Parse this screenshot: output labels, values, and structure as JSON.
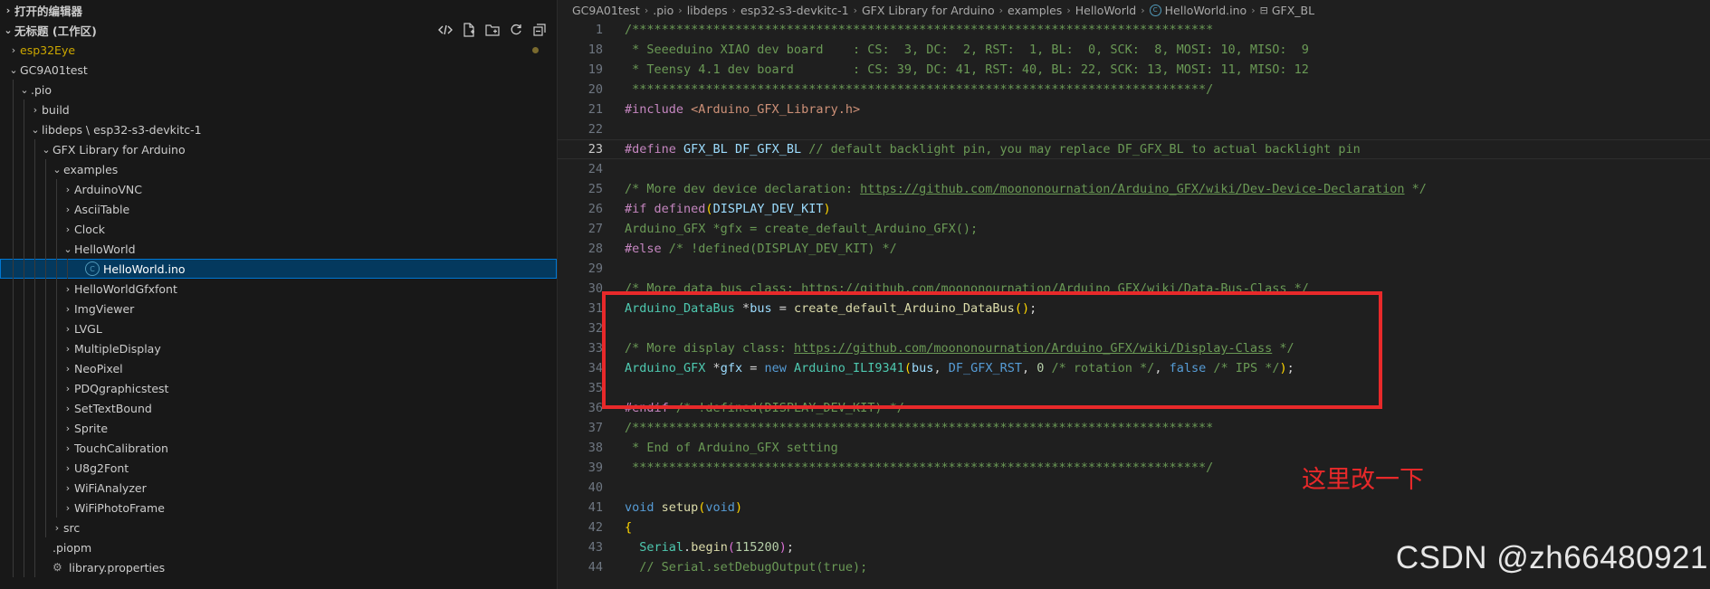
{
  "sidebar": {
    "open_editors_label": "打开的编辑器",
    "workspace_label": "无标题 (工作区)",
    "tree": [
      {
        "label": "esp32Eye",
        "depth": 0,
        "chev": "right",
        "yellow": true,
        "dot": true
      },
      {
        "label": "GC9A01test",
        "depth": 0,
        "chev": "down"
      },
      {
        "label": ".pio",
        "depth": 1,
        "chev": "down"
      },
      {
        "label": "build",
        "depth": 2,
        "chev": "right"
      },
      {
        "label": "libdeps \\ esp32-s3-devkitc-1",
        "depth": 2,
        "chev": "down"
      },
      {
        "label": "GFX Library for Arduino",
        "depth": 3,
        "chev": "down"
      },
      {
        "label": "examples",
        "depth": 4,
        "chev": "down"
      },
      {
        "label": "ArduinoVNC",
        "depth": 5,
        "chev": "right"
      },
      {
        "label": "AsciiTable",
        "depth": 5,
        "chev": "right"
      },
      {
        "label": "Clock",
        "depth": 5,
        "chev": "right"
      },
      {
        "label": "HelloWorld",
        "depth": 5,
        "chev": "down"
      },
      {
        "label": "HelloWorld.ino",
        "depth": 6,
        "chev": "none",
        "icon": "c",
        "selected": true
      },
      {
        "label": "HelloWorldGfxfont",
        "depth": 5,
        "chev": "right"
      },
      {
        "label": "ImgViewer",
        "depth": 5,
        "chev": "right"
      },
      {
        "label": "LVGL",
        "depth": 5,
        "chev": "right"
      },
      {
        "label": "MultipleDisplay",
        "depth": 5,
        "chev": "right"
      },
      {
        "label": "NeoPixel",
        "depth": 5,
        "chev": "right"
      },
      {
        "label": "PDQgraphicstest",
        "depth": 5,
        "chev": "right"
      },
      {
        "label": "SetTextBound",
        "depth": 5,
        "chev": "right"
      },
      {
        "label": "Sprite",
        "depth": 5,
        "chev": "right"
      },
      {
        "label": "TouchCalibration",
        "depth": 5,
        "chev": "right"
      },
      {
        "label": "U8g2Font",
        "depth": 5,
        "chev": "right"
      },
      {
        "label": "WiFiAnalyzer",
        "depth": 5,
        "chev": "right"
      },
      {
        "label": "WiFiPhotoFrame",
        "depth": 5,
        "chev": "right"
      },
      {
        "label": "src",
        "depth": 4,
        "chev": "right"
      },
      {
        "label": ".piopm",
        "depth": 3,
        "chev": "none"
      },
      {
        "label": "library.properties",
        "depth": 3,
        "chev": "none",
        "icon": "gear"
      }
    ]
  },
  "breadcrumb": [
    "GC9A01test",
    ".pio",
    "libdeps",
    "esp32-s3-devkitc-1",
    "GFX Library for Arduino",
    "examples",
    "HelloWorld",
    "HelloWorld.ino",
    "GFX_BL"
  ],
  "code_lines": [
    {
      "n": "1",
      "t": [
        [
          "com",
          "/*******************************************************************************"
        ]
      ]
    },
    {
      "n": "18",
      "t": [
        [
          "com",
          " * Seeeduino XIAO dev board    : CS:  3, DC:  2, RST:  1, BL:  0, SCK:  8, MOSI: 10, MISO:  9"
        ]
      ]
    },
    {
      "n": "19",
      "t": [
        [
          "com",
          " * Teensy 4.1 dev board        : CS: 39, DC: 41, RST: 40, BL: 22, SCK: 13, MOSI: 11, MISO: 12"
        ]
      ]
    },
    {
      "n": "20",
      "t": [
        [
          "com",
          " ******************************************************************************/"
        ]
      ]
    },
    {
      "n": "21",
      "t": [
        [
          "pp",
          "#include "
        ],
        [
          "inc",
          "<Arduino_GFX_Library.h>"
        ]
      ]
    },
    {
      "n": "22",
      "t": []
    },
    {
      "n": "23",
      "current": true,
      "t": [
        [
          "pp",
          "#define "
        ],
        [
          "var",
          "GFX_BL "
        ],
        [
          "var",
          "DF_GFX_BL "
        ],
        [
          "com",
          "// default backlight pin, you may replace DF_GFX_BL to actual backlight pin"
        ]
      ]
    },
    {
      "n": "24",
      "t": []
    },
    {
      "n": "25",
      "t": [
        [
          "com",
          "/* More dev device declaration: "
        ],
        [
          "url",
          "https://github.com/moononournation/Arduino_GFX/wiki/Dev-Device-Declaration"
        ],
        [
          "com",
          " */"
        ]
      ]
    },
    {
      "n": "26",
      "t": [
        [
          "pp",
          "#if "
        ],
        [
          "pp",
          "defined"
        ],
        [
          "bracket",
          "("
        ],
        [
          "var",
          "DISPLAY_DEV_KIT"
        ],
        [
          "bracket",
          ")"
        ]
      ]
    },
    {
      "n": "27",
      "t": [
        [
          "com",
          "Arduino_GFX *gfx = create_default_Arduino_GFX();"
        ]
      ]
    },
    {
      "n": "28",
      "t": [
        [
          "pp",
          "#else "
        ],
        [
          "com",
          "/* !defined(DISPLAY_DEV_KIT) */"
        ]
      ]
    },
    {
      "n": "29",
      "t": []
    },
    {
      "n": "30",
      "t": [
        [
          "com",
          "/* More data bus class: "
        ],
        [
          "url",
          "https://github.com/moononournation/Arduino_GFX/wiki/Data-Bus-Class"
        ],
        [
          "com",
          " */"
        ]
      ]
    },
    {
      "n": "31",
      "t": [
        [
          "type",
          "Arduino_DataBus "
        ],
        [
          "plain",
          "*"
        ],
        [
          "var",
          "bus "
        ],
        [
          "plain",
          "= "
        ],
        [
          "fn",
          "create_default_Arduino_DataBus"
        ],
        [
          "bracket",
          "()"
        ],
        [
          "plain",
          ";"
        ]
      ]
    },
    {
      "n": "32",
      "t": []
    },
    {
      "n": "33",
      "t": [
        [
          "com",
          "/* More display class: "
        ],
        [
          "url",
          "https://github.com/moononournation/Arduino_GFX/wiki/Display-Class"
        ],
        [
          "com",
          " */"
        ]
      ]
    },
    {
      "n": "34",
      "t": [
        [
          "type",
          "Arduino_GFX "
        ],
        [
          "plain",
          "*"
        ],
        [
          "var",
          "gfx "
        ],
        [
          "plain",
          "= "
        ],
        [
          "kw",
          "new "
        ],
        [
          "type",
          "Arduino_ILI9341"
        ],
        [
          "bracket",
          "("
        ],
        [
          "var",
          "bus"
        ],
        [
          "plain",
          ", "
        ],
        [
          "macro",
          "DF_GFX_RST"
        ],
        [
          "plain",
          ", "
        ],
        [
          "num",
          "0 "
        ],
        [
          "com",
          "/* rotation */"
        ],
        [
          "plain",
          ", "
        ],
        [
          "kw",
          "false "
        ],
        [
          "com",
          "/* IPS */"
        ],
        [
          "bracket",
          ")"
        ],
        [
          "plain",
          ";"
        ]
      ]
    },
    {
      "n": "35",
      "t": []
    },
    {
      "n": "36",
      "t": [
        [
          "pp",
          "#endif "
        ],
        [
          "com",
          "/* !defined(DISPLAY_DEV_KIT) */"
        ]
      ]
    },
    {
      "n": "37",
      "t": [
        [
          "com",
          "/*******************************************************************************"
        ]
      ]
    },
    {
      "n": "38",
      "t": [
        [
          "com",
          " * End of Arduino_GFX setting"
        ]
      ]
    },
    {
      "n": "39",
      "t": [
        [
          "com",
          " ******************************************************************************/"
        ]
      ]
    },
    {
      "n": "40",
      "t": []
    },
    {
      "n": "41",
      "t": [
        [
          "kw",
          "void "
        ],
        [
          "fn",
          "setup"
        ],
        [
          "bracket",
          "("
        ],
        [
          "kw",
          "void"
        ],
        [
          "bracket",
          ")"
        ]
      ]
    },
    {
      "n": "42",
      "t": [
        [
          "bracket",
          "{"
        ]
      ]
    },
    {
      "n": "43",
      "t": [
        [
          "plain",
          "  "
        ],
        [
          "type",
          "Serial"
        ],
        [
          "plain",
          "."
        ],
        [
          "fn",
          "begin"
        ],
        [
          "paren2",
          "("
        ],
        [
          "num",
          "115200"
        ],
        [
          "paren2",
          ")"
        ],
        [
          "plain",
          ";"
        ]
      ]
    },
    {
      "n": "44",
      "t": [
        [
          "com",
          "  // Serial.setDebugOutput(true);"
        ]
      ]
    }
  ],
  "annotation": "这里改一下",
  "watermark": "CSDN @zh66480921"
}
